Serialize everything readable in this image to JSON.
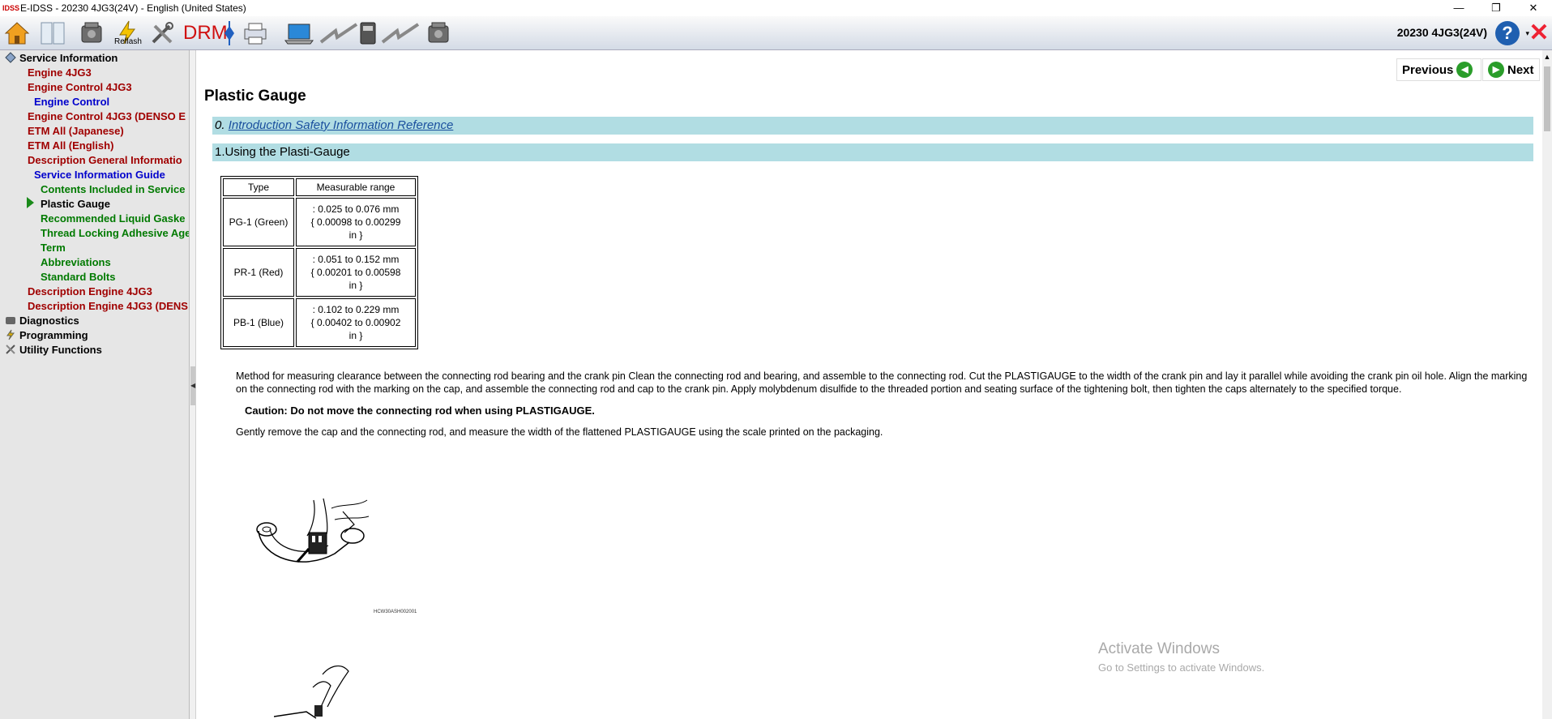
{
  "window": {
    "title": "E-IDSS - 20230 4JG3(24V)  - English (United States)",
    "logo_text": "IDSS",
    "minimize": "—",
    "restore": "❐",
    "close": "✕"
  },
  "toolbar": {
    "reflash_label": "Reflash",
    "drm_label": "DRM",
    "model": "20230 4JG3(24V)",
    "help_label": "?",
    "help_caret": "▾",
    "exit_label": "✕",
    "icons": [
      "home-icon",
      "book-icon",
      "engine-icon",
      "reflash-icon",
      "tools-icon",
      "drm-icon",
      "diamond-icon",
      "printer-icon",
      "laptop-icon",
      "lightning-icon",
      "device-icon",
      "lightning-icon",
      "engine-icon"
    ]
  },
  "sidebar": {
    "items": [
      {
        "label": "Service Information",
        "level": 0
      },
      {
        "label": "Engine 4JG3",
        "level": 1
      },
      {
        "label": "Engine Control 4JG3",
        "level": 1
      },
      {
        "label": "Engine Control",
        "level": 2
      },
      {
        "label": "Engine Control 4JG3 (DENSO E",
        "level": 1
      },
      {
        "label": "ETM All (Japanese)",
        "level": 1
      },
      {
        "label": "ETM All (English)",
        "level": 1
      },
      {
        "label": "Description General Informatio",
        "level": 1
      },
      {
        "label": "Service Information Guide",
        "level": 2
      },
      {
        "label": "Contents Included in Service",
        "level": 3
      },
      {
        "label": "Plastic Gauge",
        "level": 3,
        "selected": true
      },
      {
        "label": "Recommended Liquid Gaske",
        "level": 3
      },
      {
        "label": "Thread Locking Adhesive Age",
        "level": 3
      },
      {
        "label": "Term",
        "level": 3
      },
      {
        "label": "Abbreviations",
        "level": 3
      },
      {
        "label": "Standard Bolts",
        "level": 3
      },
      {
        "label": "Description Engine 4JG3",
        "level": 1
      },
      {
        "label": "Description Engine 4JG3 (DENS",
        "level": 1
      },
      {
        "label": "Diagnostics",
        "level": 0
      },
      {
        "label": "Programming",
        "level": 0
      },
      {
        "label": "Utility Functions",
        "level": 0
      }
    ],
    "splitter_glyph": "◀"
  },
  "content": {
    "previous_label": "Previous",
    "next_label": "Next",
    "page_title": "Plastic Gauge",
    "section0_prefix": "0. ",
    "section0_link": "Introduction Safety Information Reference",
    "section1": "1.Using the Plasti-Gauge",
    "table": {
      "headers": [
        "Type",
        "Measurable range"
      ],
      "rows": [
        {
          "type": "PG-1 (Green)",
          "line1": ":   0.025 to 0.076 mm",
          "line2": "{ 0.00098 to 0.00299",
          "line3": "in }"
        },
        {
          "type": "PR-1 (Red)",
          "line1": ":   0.051 to 0.152 mm",
          "line2": "{ 0.00201 to 0.00598",
          "line3": "in }"
        },
        {
          "type": "PB-1 (Blue)",
          "line1": ":   0.102 to 0.229 mm",
          "line2": "{ 0.00402 to 0.00902",
          "line3": "in }"
        }
      ]
    },
    "method_text": "Method for measuring clearance between the connecting rod bearing and the crank pin Clean the connecting rod and bearing, and assemble to the connecting rod. Cut the PLASTIGAUGE to the width of the crank pin and lay it parallel while avoiding the crank pin oil hole. Align the marking on the connecting rod with the marking on the cap, and assemble the connecting rod and cap to the crank pin. Apply molybdenum disulfide to the threaded portion and seating surface of the tightening bolt, then tighten the caps alternately to the specified torque.",
    "caution_text": "Caution: Do not move the connecting rod when using PLASTIGAUGE.",
    "remove_text": "Gently remove the cap and the connecting rod, and measure the width of the flattened PLASTIGAUGE using the scale printed on the packaging.",
    "figure_code": "HCW30ASH002001"
  },
  "watermark": {
    "line1": "Activate Windows",
    "line2": "Go to Settings to activate Windows."
  }
}
